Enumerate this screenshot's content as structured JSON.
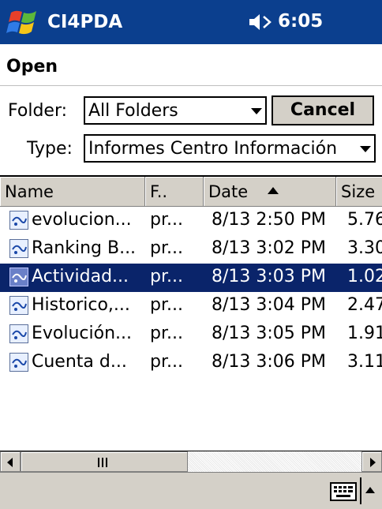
{
  "titlebar": {
    "app_title": "CI4PDA",
    "time": "6:05"
  },
  "dialog": {
    "heading": "Open"
  },
  "folder": {
    "label": "Folder:",
    "value": "All Folders"
  },
  "cancel_label": "Cancel",
  "type": {
    "label": "Type:",
    "value": "Informes Centro Información"
  },
  "columns": {
    "name": "Name",
    "folder": "F..",
    "date": "Date",
    "size": "Size"
  },
  "files": [
    {
      "name": "evolucion...",
      "folder": "pr...",
      "date": "8/13 2:50 PM",
      "size": "5.76"
    },
    {
      "name": "Ranking B...",
      "folder": "pr...",
      "date": "8/13 3:02 PM",
      "size": "3.30"
    },
    {
      "name": "Actividad...",
      "folder": "pr...",
      "date": "8/13 3:03 PM",
      "size": "1.02"
    },
    {
      "name": "Historico,...",
      "folder": "pr...",
      "date": "8/13 3:04 PM",
      "size": "2.47"
    },
    {
      "name": "Evolución...",
      "folder": "pr...",
      "date": "8/13 3:05 PM",
      "size": "1.91"
    },
    {
      "name": "Cuenta d...",
      "folder": "pr...",
      "date": "8/13 3:06 PM",
      "size": "3.11"
    }
  ],
  "selected_row": 2,
  "colors": {
    "titlebar": "#0b3f8e",
    "selection": "#0a246a",
    "chrome": "#d4d0c8"
  }
}
